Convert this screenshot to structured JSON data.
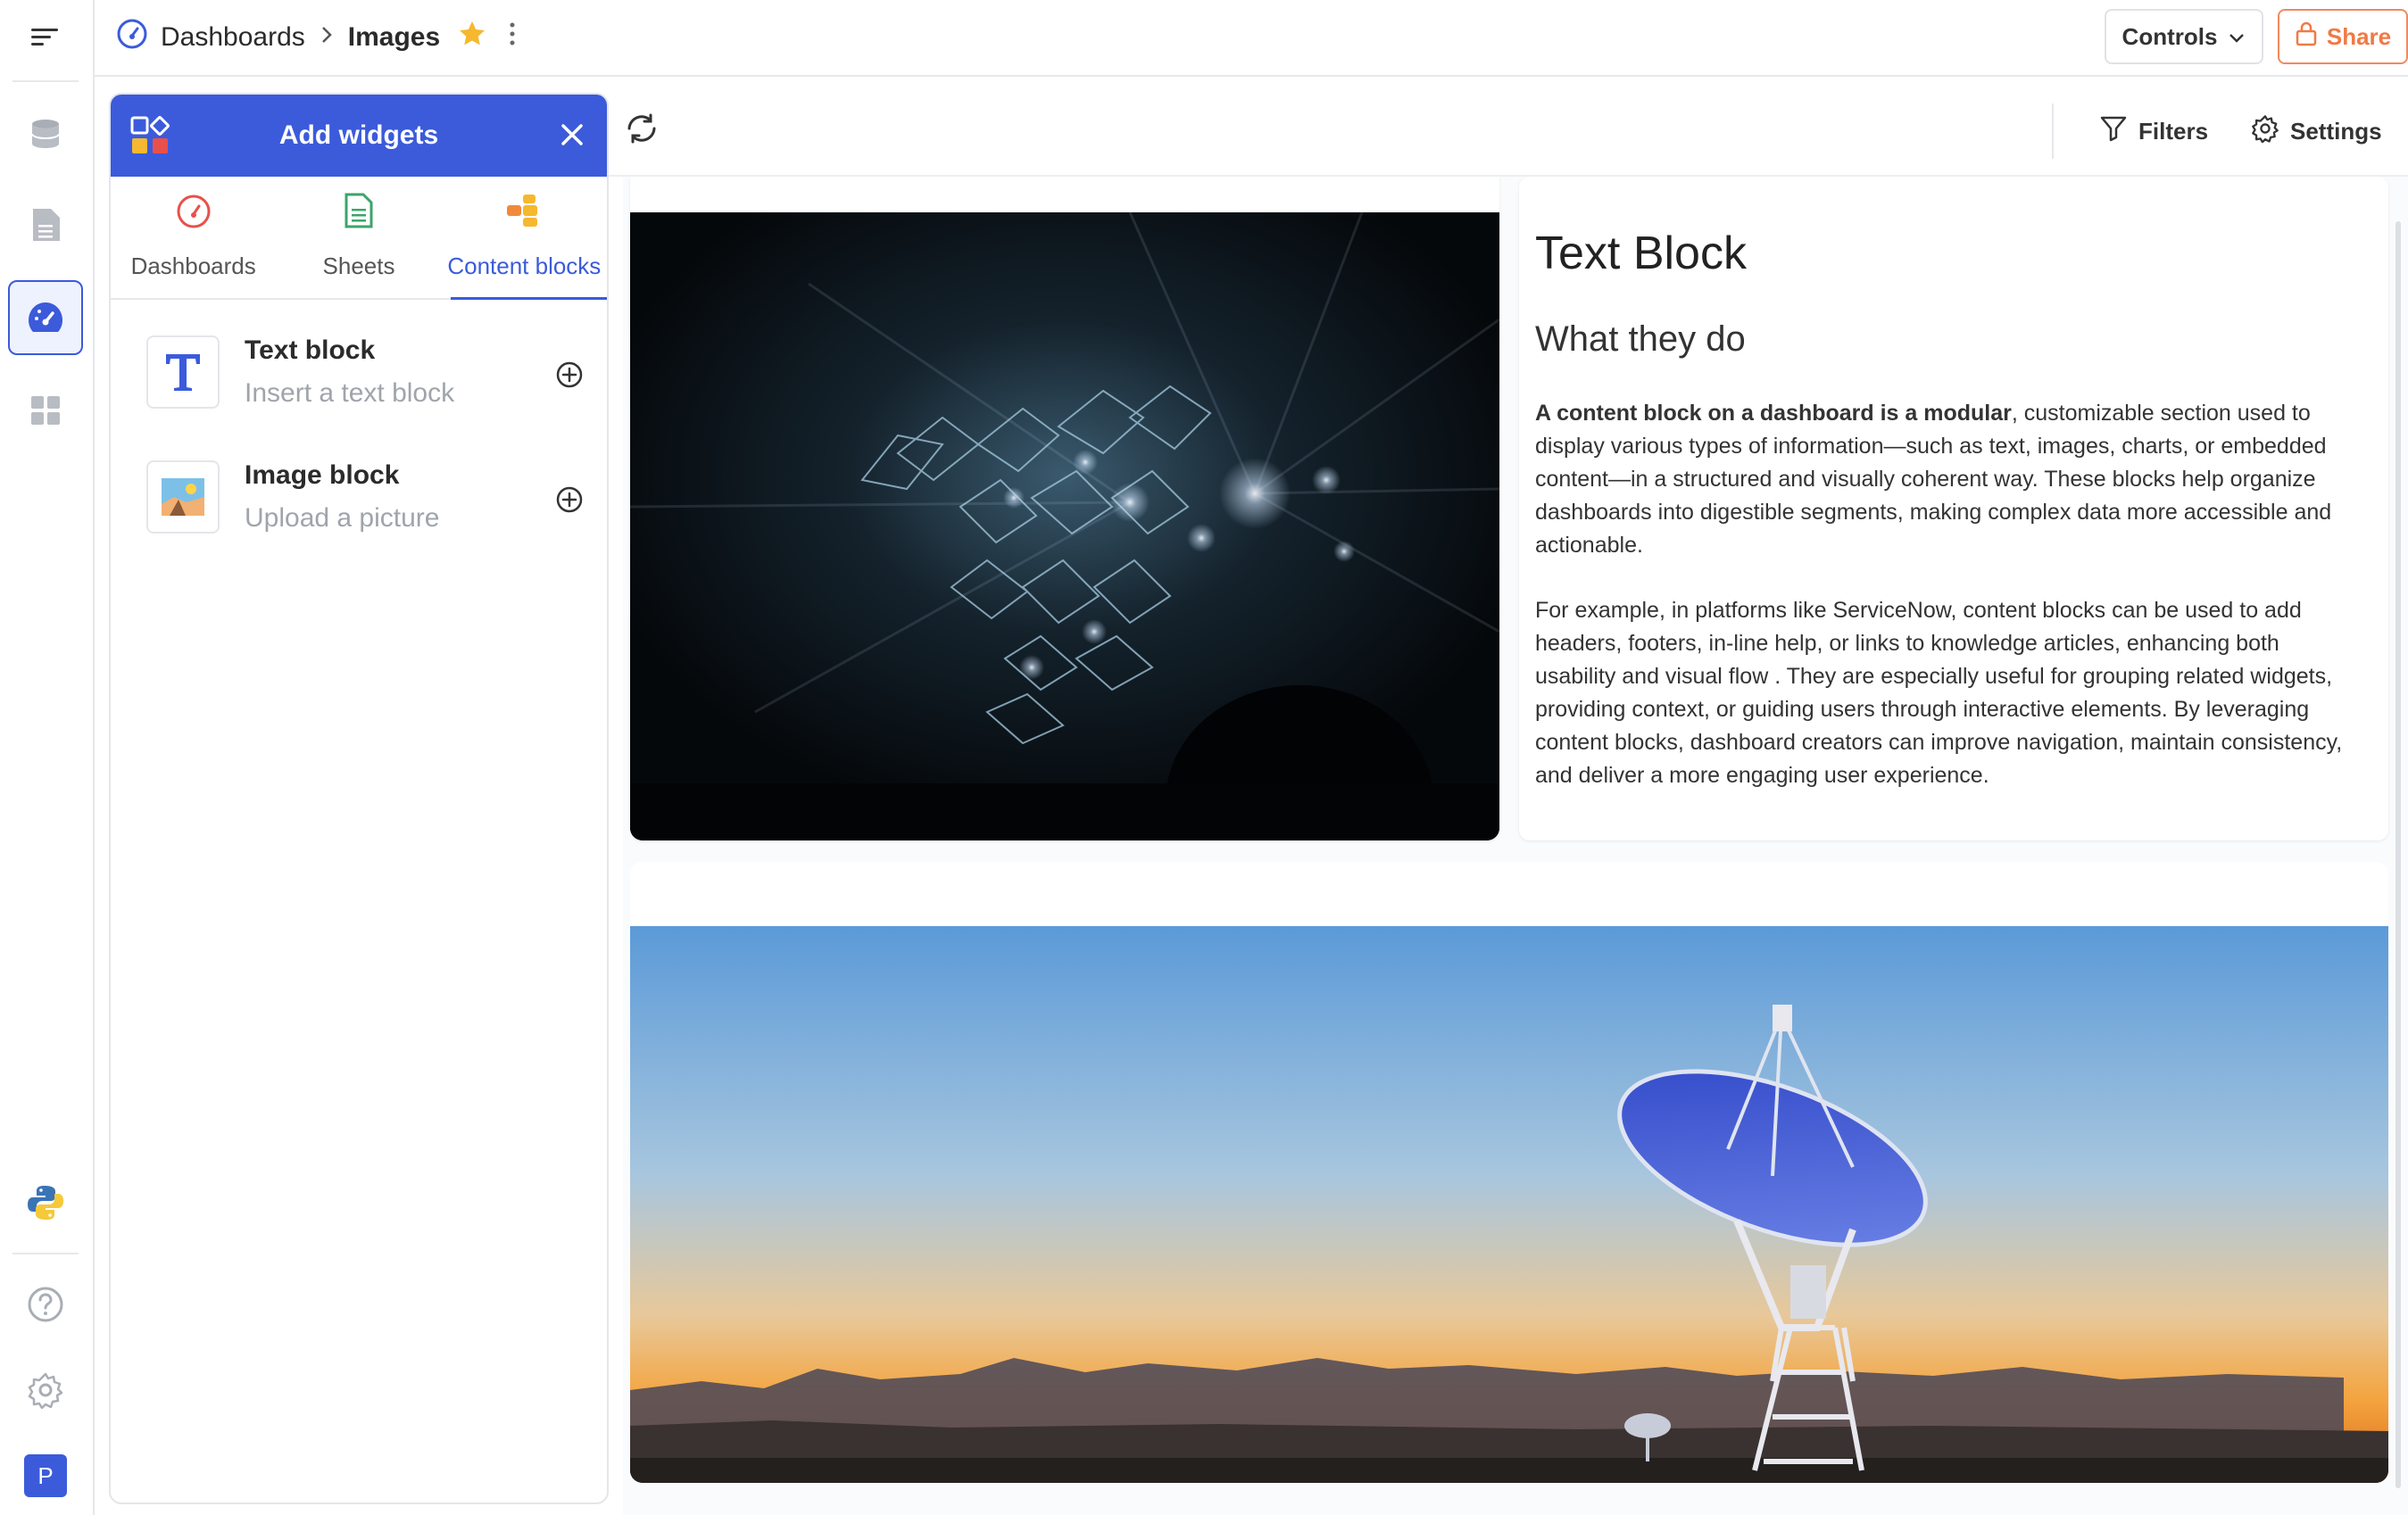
{
  "breadcrumb": {
    "parent": "Dashboards",
    "current": "Images"
  },
  "topbar": {
    "controls_label": "Controls",
    "share_label": "Share"
  },
  "toolbar": {
    "filters_label": "Filters",
    "settings_label": "Settings"
  },
  "panel": {
    "title": "Add widgets",
    "tabs": [
      {
        "label": "Dashboards",
        "icon": "gauge-icon"
      },
      {
        "label": "Sheets",
        "icon": "sheet-icon"
      },
      {
        "label": "Content blocks",
        "icon": "blocks-icon",
        "active": true
      }
    ],
    "items": [
      {
        "title": "Text block",
        "subtitle": "Insert a text block",
        "icon": "text-T-icon"
      },
      {
        "title": "Image block",
        "subtitle": "Upload a picture",
        "icon": "picture-icon"
      }
    ]
  },
  "text_block": {
    "title": "Text Block",
    "heading": "What they do",
    "para1_bold": "A content block on a dashboard is a modular",
    "para1_rest": ", customizable section used to display various types of information—such as text, images, charts, or embedded content—in a structured and visually coherent way. These blocks help organize dashboards into digestible segments, making complex data more accessible and actionable.",
    "para2": "For example, in platforms like ServiceNow, content blocks can be used to add headers, footers, in-line help, or links to knowledge articles, enhancing both usability and visual flow . They are especially useful for grouping related widgets, providing context, or guiding users through interactive elements. By leveraging content blocks, dashboard creators can improve navigation, maintain consistency, and deliver a more engaging user experience."
  },
  "rail": {
    "avatar_letter": "P"
  },
  "colors": {
    "accent": "#3b5bdb",
    "share": "#f07a45",
    "star": "#f5b82e"
  }
}
